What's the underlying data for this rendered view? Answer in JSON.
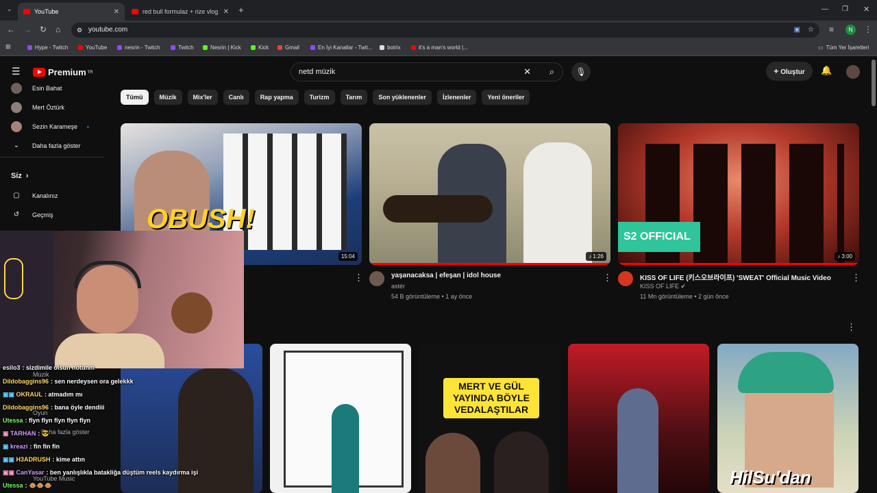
{
  "browser": {
    "tabs": [
      {
        "label": "YouTube"
      },
      {
        "label": "red bull formulaz + rize vlog - \\"
      }
    ],
    "address": "youtube.com",
    "bookmarks": [
      "Hype - Twitch",
      "YouTube",
      "nesrin - Twitch",
      "Twitch",
      "Nesrin | Kick",
      "Kick",
      "Gmail",
      "En İyi Kanallar - Twit...",
      "botrix",
      "it's a man's world |..."
    ],
    "all_bookmarks": "Tüm Yer İşaretleri",
    "profile_initial": "N"
  },
  "header": {
    "logo": "Premium",
    "logo_badge": "TR",
    "search_value": "netd müzik",
    "create_label": "Oluştur"
  },
  "sidebar": {
    "subscriptions": [
      {
        "label": "Esin Bahat"
      },
      {
        "label": "Mert Öztürk"
      },
      {
        "label": "Sezin Karameşe"
      }
    ],
    "show_more": "Daha fazla göster",
    "you_label": "Siz",
    "your_channel": "Kanalınız",
    "history": "Geçmiş",
    "music": "Müzik",
    "game": "Oyun",
    "show_more_2": "Daha fazla göster",
    "yt_music": "YouTube Music",
    "yt_studio": "YouTube Studio"
  },
  "chips": [
    "Tümü",
    "Müzik",
    "Mix'ler",
    "Canlı",
    "Rap yapma",
    "Turizm",
    "Tarım",
    "Son yüklenenler",
    "İzlenenler",
    "Yeni öneriler"
  ],
  "videos": [
    {
      "title": "",
      "duration": "15:04",
      "thumb_text": "OBUSH!"
    },
    {
      "title": "yaşanacaksa | efeşan | idol house",
      "channel": "astér",
      "meta": "54 B görüntüleme • 1 ay önce",
      "duration": "1:26"
    },
    {
      "title": "KISS OF LIFE (키스오브라이프) 'SWEAT' Official Music Video",
      "channel": "KISS OF LIFE",
      "meta": "11 Mn görüntüleme • 2 gün önce",
      "duration": "3:00",
      "thumb_text": "S2 OFFICIAL"
    }
  ],
  "shorts": [
    {
      "text": ""
    },
    {
      "text": ""
    },
    {
      "text": "MERT VE GÜL YAYINDA BÖYLE VEDALAŞTILAR"
    },
    {
      "text": ""
    },
    {
      "text": "HilSu'dan"
    }
  ],
  "chat": [
    {
      "user": "esilo3",
      "text": ": sizdimile olsun notunm",
      "color": "#ffffff"
    },
    {
      "user": "Dildobaggins96",
      "text": ": sen nerdeysen ora gelekkk",
      "color": "#ffd966"
    },
    {
      "user": "OKRAUL",
      "text": ": atmadım mı",
      "color": "#ffd966"
    },
    {
      "user": "Dildobaggins96",
      "text": ": bana öyle dendiii",
      "color": "#ffd966"
    },
    {
      "user": "Utessa",
      "text": ": flyn flyn flyn flyn flyn",
      "color": "#7cff6b"
    },
    {
      "user": "TARHAN",
      "text": ": ",
      "color": "#d49cff"
    },
    {
      "user": "kreazi",
      "text": ": fin fin fin",
      "color": "#d49cff"
    },
    {
      "user": "H3ADRUSH",
      "text": ": kime attın",
      "color": "#ffd966"
    },
    {
      "user": "CanYasar",
      "text": ": ben yanlışlıkla batakliğa düştüm reels kaydırma işi",
      "color": "#d49cff"
    },
    {
      "user": "Utessa",
      "text": ":",
      "color": "#7cff6b"
    }
  ]
}
